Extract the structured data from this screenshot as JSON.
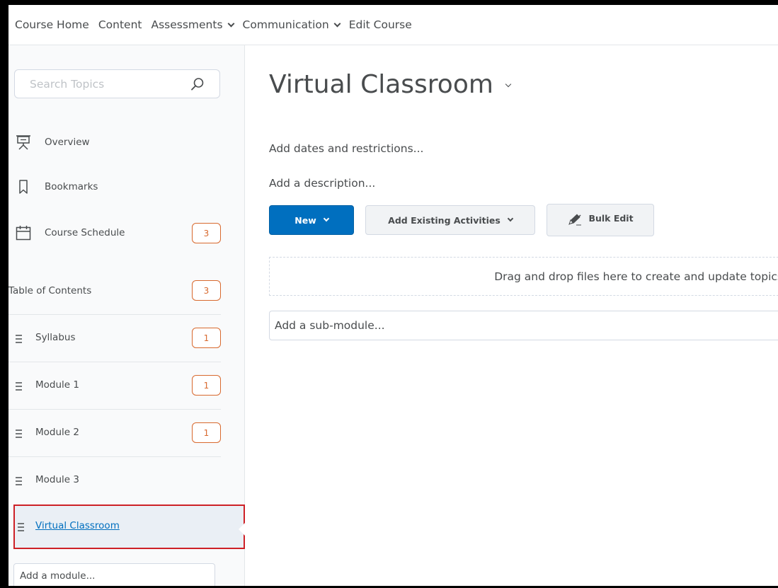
{
  "topnav": {
    "items": [
      {
        "label": "Course Home",
        "dropdown": false
      },
      {
        "label": "Content",
        "dropdown": false
      },
      {
        "label": "Assessments",
        "dropdown": true
      },
      {
        "label": "Communication",
        "dropdown": true
      },
      {
        "label": "Edit Course",
        "dropdown": false
      }
    ]
  },
  "sidebar": {
    "search_placeholder": "Search Topics",
    "overview": {
      "label": "Overview",
      "icon": "presentation-board-icon"
    },
    "bookmarks": {
      "label": "Bookmarks",
      "icon": "bookmark-icon"
    },
    "schedule": {
      "label": "Course Schedule",
      "icon": "calendar-icon",
      "badge": "3"
    },
    "toc": {
      "label": "Table of Contents",
      "badge": "3"
    },
    "modules": [
      {
        "label": "Syllabus",
        "badge": "1"
      },
      {
        "label": "Module 1",
        "badge": "1"
      },
      {
        "label": "Module 2",
        "badge": "1"
      },
      {
        "label": "Module 3",
        "badge": ""
      }
    ],
    "selected_module": {
      "label": "Virtual Classroom"
    },
    "add_module": "Add a module..."
  },
  "main": {
    "title": "Virtual Classroom",
    "dates_link": "Add dates and restrictions...",
    "description_link": "Add a description...",
    "buttons": {
      "new": "New",
      "add_existing": "Add Existing Activities",
      "bulk_edit": "Bulk Edit"
    },
    "dropzone_text": "Drag and drop files here to create and update topics",
    "submodule_placeholder": "Add a sub-module..."
  },
  "colors": {
    "primary": "#006fbf",
    "badge": "#d8692e",
    "selection_outline": "#cd2026",
    "text": "#494c4e"
  }
}
